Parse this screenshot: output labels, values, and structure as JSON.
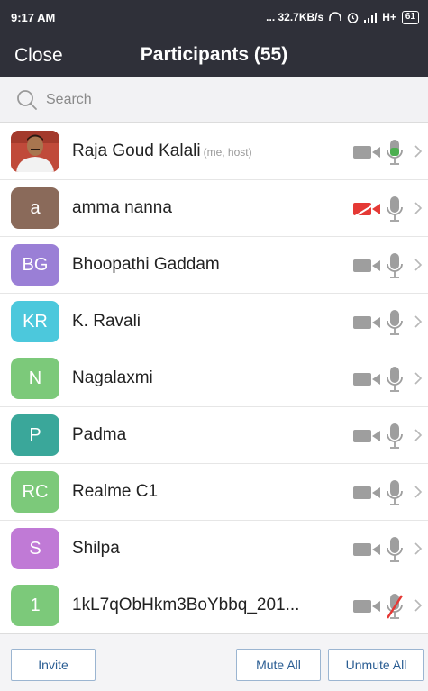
{
  "status_bar": {
    "time": "9:17 AM",
    "network_info": "... 32.7KB/s",
    "signal_text": "H+",
    "battery": "61"
  },
  "header": {
    "close_label": "Close",
    "title": "Participants (55)"
  },
  "search": {
    "placeholder": "Search"
  },
  "participants": [
    {
      "name": "Raja Goud Kalali",
      "role": "(me, host)",
      "initials": "",
      "avatar_color": "#c04a3a",
      "photo": true,
      "video_off_red": false,
      "mic_state": "active"
    },
    {
      "name": "amma nanna",
      "role": "",
      "initials": "a",
      "avatar_color": "#8a6a5a",
      "photo": false,
      "video_off_red": true,
      "mic_state": "normal"
    },
    {
      "name": "Bhoopathi Gaddam",
      "role": "",
      "initials": "BG",
      "avatar_color": "#9a7fd6",
      "photo": false,
      "video_off_red": false,
      "mic_state": "normal"
    },
    {
      "name": "K. Ravali",
      "role": "",
      "initials": "KR",
      "avatar_color": "#4cc8dc",
      "photo": false,
      "video_off_red": false,
      "mic_state": "normal"
    },
    {
      "name": "Nagalaxmi",
      "role": "",
      "initials": "N",
      "avatar_color": "#7cc97a",
      "photo": false,
      "video_off_red": false,
      "mic_state": "normal"
    },
    {
      "name": "Padma",
      "role": "",
      "initials": "P",
      "avatar_color": "#3aa79a",
      "photo": false,
      "video_off_red": false,
      "mic_state": "normal"
    },
    {
      "name": "Realme C1",
      "role": "",
      "initials": "RC",
      "avatar_color": "#7cc97a",
      "photo": false,
      "video_off_red": false,
      "mic_state": "normal"
    },
    {
      "name": "Shilpa",
      "role": "",
      "initials": "S",
      "avatar_color": "#c07ad6",
      "photo": false,
      "video_off_red": false,
      "mic_state": "normal"
    },
    {
      "name": "1kL7qObHkm3BoYbbq_201...",
      "role": "",
      "initials": "1",
      "avatar_color": "#7cc97a",
      "photo": false,
      "video_off_red": false,
      "mic_state": "muted"
    }
  ],
  "footer": {
    "invite_label": "Invite",
    "mute_all_label": "Mute All",
    "unmute_all_label": "Unmute All"
  },
  "colors": {
    "header_bg": "#2f3039",
    "mic_active": "#4caf50",
    "muted_red": "#e53935",
    "icon_gray": "#9e9e9e",
    "button_text": "#2a5d93"
  }
}
